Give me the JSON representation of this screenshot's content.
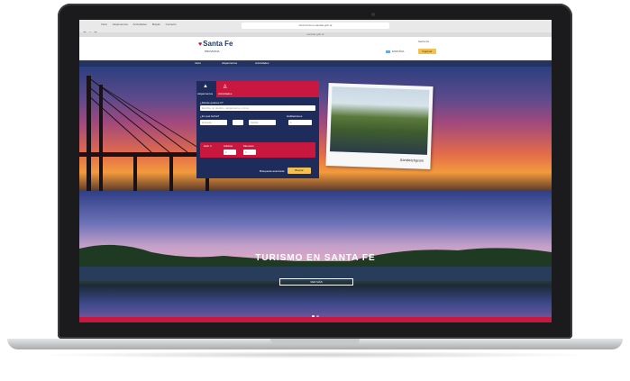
{
  "browser": {
    "url": "www.turismo.santafe.gob.ar",
    "tabs": [
      "Inicio",
      "Alojamientos",
      "Actividades",
      "Mapas",
      "Contacto"
    ],
    "tab_strip": "santafe.gob.ar"
  },
  "header": {
    "logo_text": "Santa Fe",
    "logo_sub": "PROVINCIA",
    "top_link": "Santa Fe",
    "language": "ESPAÑOL",
    "cta_label": "Ingresar"
  },
  "nav": {
    "items": [
      "Inicio",
      "Alojamientos",
      "Actividades"
    ]
  },
  "booking": {
    "tab_lodging": "Alojamientos",
    "tab_activities": "Actividades",
    "where_label": "¿Dónde quieres ir?",
    "where_placeholder": "Escribe un destino, alojamiento o zona",
    "when_label": "¿En qué fecha?",
    "checkin_placeholder": "Entrada",
    "checkout_placeholder": "Salida",
    "rooms_label": "Habitaciones",
    "rooms_value": "1",
    "room_label": "Hab. 1",
    "adults_label": "Adultos",
    "adults_value": "2",
    "kids_label": "Menores",
    "kids_value": "0",
    "advanced_link": "Búsqueda avanzada",
    "search_button": "Buscar"
  },
  "photo": {
    "caption": "Sandwichgram"
  },
  "hero_lower": {
    "title": "TURISMO EN SANTA FE",
    "button": "VER MÁS"
  },
  "colors": {
    "navy": "#24335f",
    "red": "#c8183f",
    "gold": "#f2c14e"
  }
}
